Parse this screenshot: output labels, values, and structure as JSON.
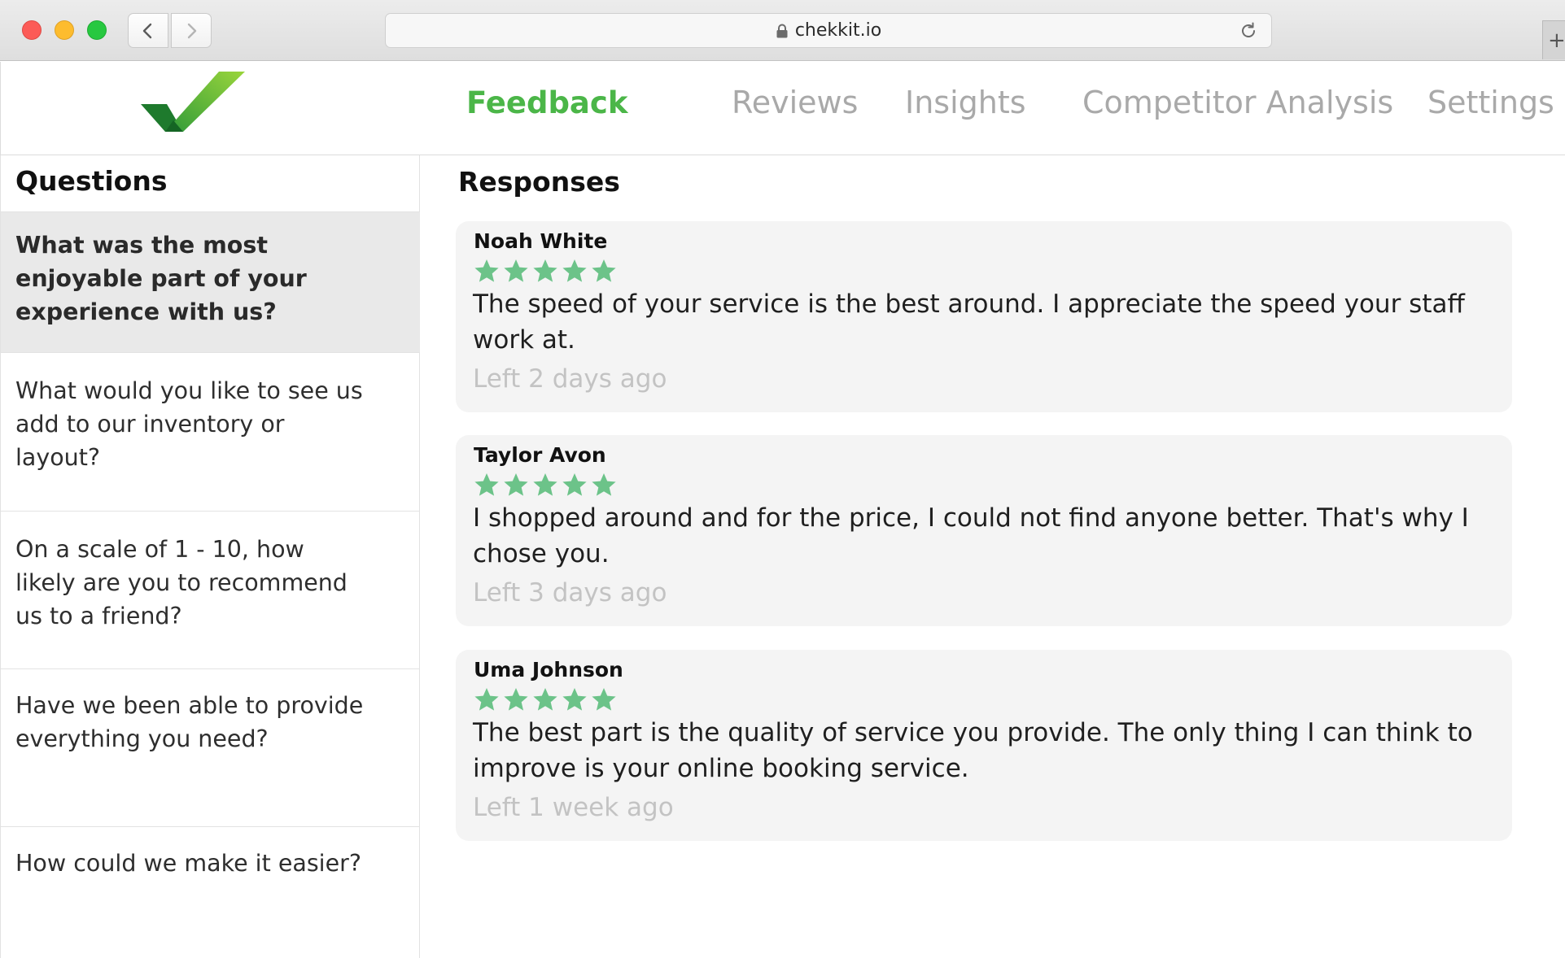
{
  "browser": {
    "url": "chekkit.io",
    "new_tab_symbol": "+"
  },
  "nav": {
    "items": [
      {
        "label": "Feedback",
        "active": true
      },
      {
        "label": "Reviews",
        "active": false
      },
      {
        "label": "Insights",
        "active": false
      },
      {
        "label": "Competitor Analysis",
        "active": false
      },
      {
        "label": "Settings",
        "active": false
      }
    ]
  },
  "questions": {
    "title": "Questions",
    "items": [
      {
        "text": "What was the most enjoyable part of your experience with us?",
        "selected": true
      },
      {
        "text": "What would you like to see us add to our inventory or layout?",
        "selected": false
      },
      {
        "text": "On a scale of 1 - 10, how likely are you to recommend us to a friend?",
        "selected": false
      },
      {
        "text": "Have we been able to provide everything you need?",
        "selected": false
      },
      {
        "text": "How could we make it easier?",
        "selected": false
      }
    ]
  },
  "responses": {
    "title": "Responses",
    "items": [
      {
        "author": "Noah White",
        "rating": 5,
        "text": "The speed of your service is the best around. I appreciate the speed your staff work at.",
        "time": "Left 2 days ago"
      },
      {
        "author": "Taylor Avon",
        "rating": 5,
        "text": "I shopped around and for the price, I could not find anyone better. That's why I chose you.",
        "time": "Left 3 days ago"
      },
      {
        "author": "Uma Johnson",
        "rating": 5,
        "text": "The best part is the quality of service you provide. The only thing I can think to improve is your online booking service.",
        "time": "Left 1 week ago"
      }
    ]
  },
  "colors": {
    "brand_green": "#4bb648",
    "star_green": "#6cc389",
    "nav_inactive": "#a9a9a9",
    "timestamp": "#c3c3c3",
    "card_bg": "#f4f4f4",
    "selected_bg": "#e9e9e9"
  },
  "icons": {
    "logo": "checkmark-logo",
    "star": "star-icon",
    "lock": "lock-icon",
    "reload": "reload-icon",
    "back": "chevron-left-icon",
    "forward": "chevron-right-icon"
  }
}
